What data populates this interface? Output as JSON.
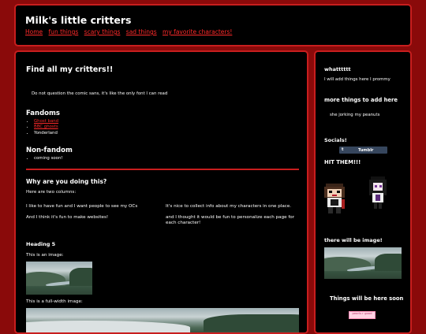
{
  "header": {
    "site_title": "Milk's little critters",
    "nav": [
      "Home",
      "fun things",
      "scary things",
      "sad things",
      "my favorite characters!"
    ]
  },
  "main": {
    "heading": "Find all my critters!!",
    "comic_note": "Do not question the comic sans, it's like the only font I can read",
    "fandoms_heading": "Fandoms",
    "fandoms": [
      "Ghost band",
      "BBC ghosts",
      "Yonderland"
    ],
    "nonfandom_heading": "Non-fandom",
    "nonfandom": [
      "coming soon!"
    ],
    "why_heading": "Why are you doing this?",
    "two_columns": "Here are two columns:",
    "col1": [
      "I like to have fun and I want people to see my OCs",
      "And I think it's fun to make websites!"
    ],
    "col2": [
      "It's nice to collect info about my characters in one place.",
      "and I thought it would be fun to personalize each page for each character!"
    ],
    "heading5": "Heading 5",
    "image_caption": "This is an image:",
    "full_width_caption": "This is a full-width image:"
  },
  "sidebar": {
    "s1_heading": "whatttttt",
    "s1_text": "I will add things here I prommy",
    "s2_heading": "more things to add here",
    "s2_text": "she jorking my peanuts",
    "socials_heading": "Socials!",
    "tumblr_label": "Tumblr",
    "hit_heading": "HIT THEM!!!",
    "image_heading": "there will be image!",
    "things_heading": "Things will be here soon",
    "sticker_text": "pearls r good"
  },
  "colors": {
    "background": "#8a0a0a",
    "panel": "#000000",
    "border": "#c81e1e",
    "link": "#ff2a2a"
  }
}
